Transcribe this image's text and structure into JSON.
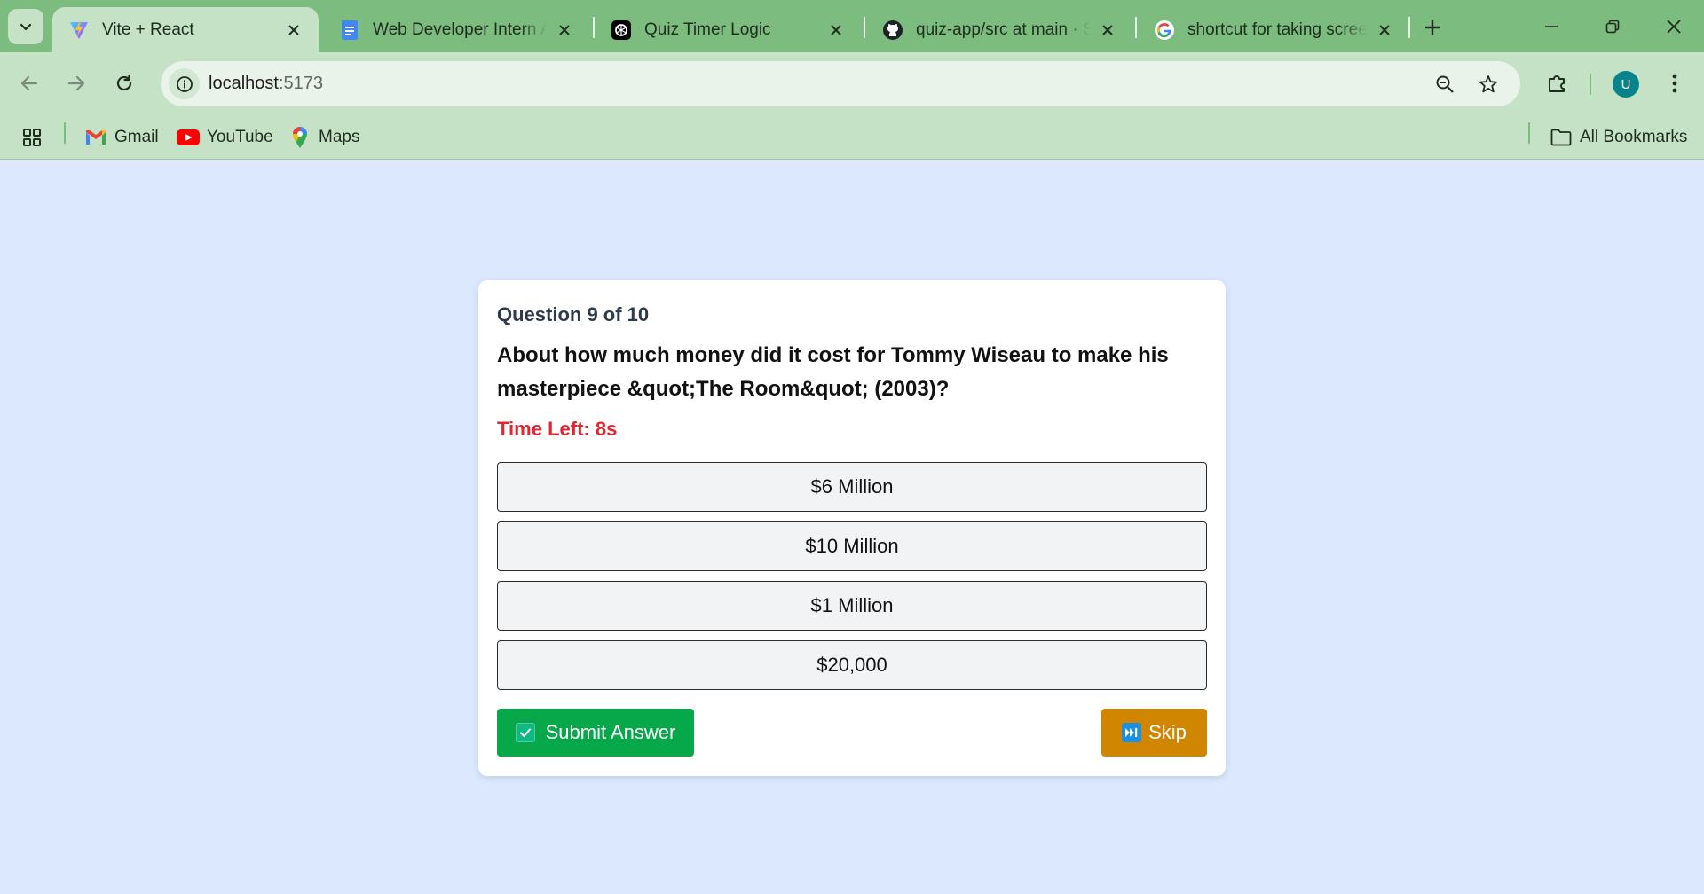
{
  "browser": {
    "tabs": [
      {
        "title": "Vite + React",
        "icon": "vite-icon",
        "active": true
      },
      {
        "title": "Web Developer Intern As",
        "icon": "google-docs-icon",
        "active": false
      },
      {
        "title": "Quiz Timer Logic",
        "icon": "chatgpt-icon",
        "active": false
      },
      {
        "title": "quiz-app/src at main · Sh",
        "icon": "github-icon",
        "active": false
      },
      {
        "title": "shortcut for taking screen",
        "icon": "google-icon",
        "active": false
      }
    ],
    "address": {
      "host": "localhost",
      "port": ":5173"
    },
    "avatar_letter": "U",
    "bookmarks": [
      {
        "label": "Gmail",
        "icon": "gmail-icon"
      },
      {
        "label": "YouTube",
        "icon": "youtube-icon"
      },
      {
        "label": "Maps",
        "icon": "maps-icon"
      }
    ],
    "all_bookmarks_label": "All Bookmarks"
  },
  "quiz": {
    "counter": "Question 9 of 10",
    "question": "About how much money did it cost for Tommy Wiseau to make his masterpiece &quot;The Room&quot; (2003)?",
    "timer": "Time Left: 8s",
    "options": [
      "$6 Million",
      "$10 Million",
      "$1 Million",
      "$20,000"
    ],
    "submit_label": "Submit Answer",
    "skip_label": "Skip"
  },
  "colors": {
    "tabstrip": "#7dbc7f",
    "toolbar": "#c5e2c7",
    "page_bg": "#dbe8fd",
    "timer": "#e4252f",
    "submit": "#06a84a",
    "skip": "#d08600"
  }
}
